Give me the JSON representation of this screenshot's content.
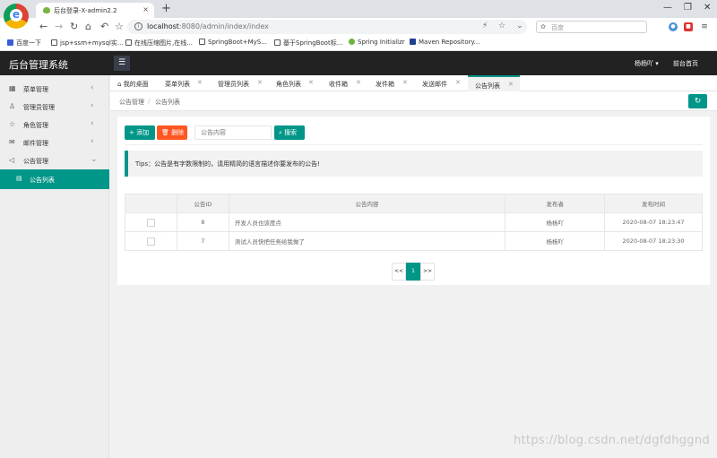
{
  "browser": {
    "tab_title": "后台登录-X-admin2.2",
    "tab_close": "×",
    "new_tab": "+",
    "url_host": "localhost",
    "url_path": ":8080/admin/index/index",
    "search_placeholder": "百度",
    "bookmarks": [
      "百度一下",
      "jsp+ssm+mysql实...",
      "在线压缩图片,在线...",
      "SpringBoot+MyS...",
      "基于SpringBoot标...",
      "Spring Initializr",
      "Maven Repository..."
    ]
  },
  "app": {
    "logo": "后台管理系统",
    "user": "杨杨吖 ▾",
    "front_page": "前台首页"
  },
  "sidebar": {
    "items": [
      {
        "label": "菜单管理",
        "icon": "grid-icon"
      },
      {
        "label": "管理员管理",
        "icon": "user-icon"
      },
      {
        "label": "角色管理",
        "icon": "star-icon"
      },
      {
        "label": "邮件管理",
        "icon": "mail-icon"
      },
      {
        "label": "公告管理",
        "icon": "speaker-icon"
      }
    ],
    "active_sub": "公告列表"
  },
  "tabs": [
    "我的桌面",
    "菜单列表",
    "管理员列表",
    "角色列表",
    "收件箱",
    "发件箱",
    "发送邮件",
    "公告列表"
  ],
  "breadcrumb": {
    "parent": "公告管理",
    "sep": "/",
    "current": "公告列表"
  },
  "toolbar": {
    "add_label": "添加",
    "delete_label": "删除",
    "search_placeholder": "公告内容",
    "search_label": "搜索"
  },
  "tips": "Tips：公告是有字数限制的，请用精简的语言描述你要发布的公告!",
  "table": {
    "headers": [
      "",
      "公告ID",
      "公告内容",
      "发布者",
      "发布时间"
    ],
    "rows": [
      {
        "id": "8",
        "content": "开发人员也该度点",
        "publisher": "杨杨吖",
        "time": "2020-08-07 18:23:47"
      },
      {
        "id": "7",
        "content": "测试人员快把任务给我做了",
        "publisher": "杨杨吖",
        "time": "2020-08-07 18:23:30"
      }
    ]
  },
  "pagination": {
    "prev": "<<",
    "current": "1",
    "next": ">>"
  },
  "watermark": "https://blog.csdn.net/dgfdhggnd",
  "colors": {
    "accent": "#009688",
    "danger": "#ff5722",
    "header": "#222222"
  }
}
